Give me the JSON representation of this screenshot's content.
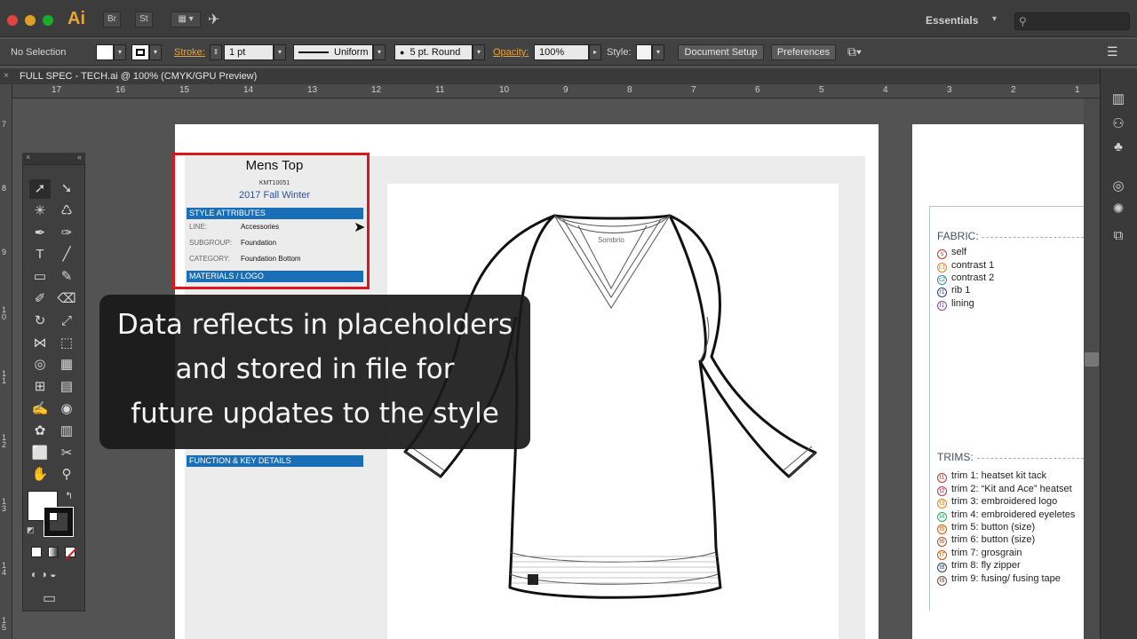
{
  "app": {
    "name": "Ai",
    "bridge_label": "Br",
    "stock_label": "St",
    "workspace": "Essentials"
  },
  "control_bar": {
    "selection": "No Selection",
    "stroke_label": "Stroke:",
    "stroke_value": "1 pt",
    "stroke_profile": "Uniform",
    "brush": "5 pt. Round",
    "opacity_label": "Opacity:",
    "opacity_value": "100%",
    "style_label": "Style:",
    "document_setup": "Document Setup",
    "preferences": "Preferences"
  },
  "document_tab": {
    "title": "FULL SPEC - TECH.ai @ 100% (CMYK/GPU Preview)",
    "close": "×"
  },
  "rulers": {
    "horizontal": [
      "17",
      "16",
      "15",
      "14",
      "13",
      "12",
      "11",
      "10",
      "9",
      "8",
      "7",
      "6",
      "5",
      "4",
      "3",
      "2",
      "1"
    ],
    "vertical": [
      "7",
      "8",
      "9",
      "1\n0",
      "1\n1",
      "1\n2",
      "1\n3",
      "1\n4",
      "1\n5"
    ]
  },
  "info_panel": {
    "title": "Mens Top",
    "code": "KMT10051",
    "season": "2017 Fall Winter",
    "style_attributes_header": "STYLE ATTRIBUTES",
    "attributes": [
      {
        "label": "LINE:",
        "value": "Accessories"
      },
      {
        "label": "SUBGROUP:",
        "value": "Foundation"
      },
      {
        "label": "CATEGORY:",
        "value": "Foundation Bottom"
      }
    ],
    "materials_header": "MATERIALS / LOGO",
    "function_header": "FUNCTION & KEY DETAILS"
  },
  "garment": {
    "brand_label": "Sombrio"
  },
  "caption": {
    "line1": "Data reflects in placeholders",
    "line2": "and stored in file for",
    "line3": "future updates to the style"
  },
  "legend": {
    "fabric_heading": "FABRIC:",
    "fabrics": [
      {
        "code": "S",
        "label": "self",
        "color": "#c0392b"
      },
      {
        "code": "C1",
        "label": "contrast 1",
        "color": "#e67e22"
      },
      {
        "code": "C2",
        "label": "contrast 2",
        "color": "#2a8fa6"
      },
      {
        "code": "R1",
        "label": "rib 1",
        "color": "#2c3e70"
      },
      {
        "code": "L1",
        "label": "lining",
        "color": "#8e44ad"
      }
    ],
    "trims_heading": "TRIMS:",
    "trims": [
      {
        "code": "T1",
        "label": "trim 1: heatset kit tack",
        "color": "#c0392b"
      },
      {
        "code": "T2",
        "label": "trim 2: “Kit and Ace” heatset",
        "color": "#b03a5b"
      },
      {
        "code": "T3",
        "label": "trim 3: embroidered logo",
        "color": "#e67e22"
      },
      {
        "code": "T4",
        "label": "trim 4: embroidered eyeletes",
        "color": "#27ae60"
      },
      {
        "code": "T5",
        "label": "trim 5: button (size)",
        "color": "#d35400"
      },
      {
        "code": "T6",
        "label": "trim 6: button (size)",
        "color": "#a0522d"
      },
      {
        "code": "T7",
        "label": "trim 7: grosgrain",
        "color": "#d35400"
      },
      {
        "code": "T8",
        "label": "trim 8: fly zipper",
        "color": "#2c3e70"
      },
      {
        "code": "T9",
        "label": "trim 9: fusing/ fusing tape",
        "color": "#6d4c41"
      }
    ]
  },
  "tools": [
    {
      "name": "selection-tool-icon",
      "glyph": "➚"
    },
    {
      "name": "direct-selection-tool-icon",
      "glyph": "➘"
    },
    {
      "name": "magic-wand-tool-icon",
      "glyph": "✳"
    },
    {
      "name": "lasso-tool-icon",
      "glyph": "♺"
    },
    {
      "name": "pen-tool-icon",
      "glyph": "✒"
    },
    {
      "name": "curvature-tool-icon",
      "glyph": "✑"
    },
    {
      "name": "type-tool-icon",
      "glyph": "T"
    },
    {
      "name": "line-tool-icon",
      "glyph": "╱"
    },
    {
      "name": "rectangle-tool-icon",
      "glyph": "▭"
    },
    {
      "name": "paintbrush-tool-icon",
      "glyph": "✎"
    },
    {
      "name": "shaper-tool-icon",
      "glyph": "✐"
    },
    {
      "name": "eraser-tool-icon",
      "glyph": "⌫"
    },
    {
      "name": "rotate-tool-icon",
      "glyph": "↻"
    },
    {
      "name": "scale-tool-icon",
      "glyph": "⤢"
    },
    {
      "name": "width-tool-icon",
      "glyph": "⋈"
    },
    {
      "name": "free-transform-tool-icon",
      "glyph": "⬚"
    },
    {
      "name": "shape-builder-tool-icon",
      "glyph": "◎"
    },
    {
      "name": "perspective-grid-tool-icon",
      "glyph": "▦"
    },
    {
      "name": "mesh-tool-icon",
      "glyph": "⊞"
    },
    {
      "name": "gradient-tool-icon",
      "glyph": "▤"
    },
    {
      "name": "eyedropper-tool-icon",
      "glyph": "✍"
    },
    {
      "name": "blend-tool-icon",
      "glyph": "◉"
    },
    {
      "name": "symbol-sprayer-tool-icon",
      "glyph": "✿"
    },
    {
      "name": "column-graph-tool-icon",
      "glyph": "▥"
    },
    {
      "name": "artboard-tool-icon",
      "glyph": "⬜"
    },
    {
      "name": "slice-tool-icon",
      "glyph": "✂"
    },
    {
      "name": "hand-tool-icon",
      "glyph": "✋"
    },
    {
      "name": "zoom-tool-icon",
      "glyph": "⚲"
    }
  ],
  "dock_icons": [
    "libraries-icon",
    "layers-icon",
    "symbols-icon",
    "color-icon",
    "appearance-icon",
    "artboards-icon"
  ],
  "colors": {
    "accent_blue": "#1a6eb6",
    "highlight_red": "#e0141b",
    "stroke_orange": "#e8a33b"
  }
}
